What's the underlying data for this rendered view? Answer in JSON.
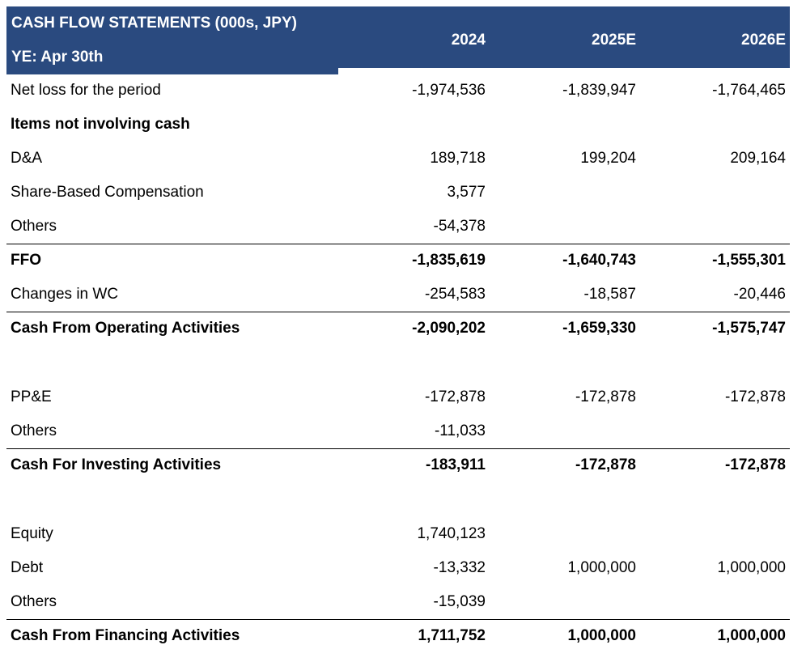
{
  "header": {
    "title": "CASH FLOW STATEMENTS (000s, JPY)",
    "subtitle": "YE: Apr 30th",
    "columns": [
      "2024",
      "2025E",
      "2026E"
    ]
  },
  "rows": [
    {
      "label": "Net loss for the period",
      "values": [
        "-1,974,536",
        "-1,839,947",
        "-1,764,465"
      ]
    },
    {
      "label": "Items not involving cash",
      "values": [
        "",
        "",
        ""
      ]
    },
    {
      "label": "D&A",
      "values": [
        "189,718",
        "199,204",
        "209,164"
      ]
    },
    {
      "label": "Share-Based Compensation",
      "values": [
        "3,577",
        "",
        ""
      ]
    },
    {
      "label": "Others",
      "values": [
        "-54,378",
        "",
        ""
      ]
    },
    {
      "label": "FFO",
      "values": [
        "-1,835,619",
        "-1,640,743",
        "-1,555,301"
      ]
    },
    {
      "label": "Changes in WC",
      "values": [
        "-254,583",
        "-18,587",
        "-20,446"
      ]
    },
    {
      "label": "Cash From Operating Activities",
      "values": [
        "-2,090,202",
        "-1,659,330",
        "-1,575,747"
      ]
    },
    {
      "label": "",
      "values": [
        "",
        "",
        ""
      ]
    },
    {
      "label": "PP&E",
      "values": [
        "-172,878",
        "-172,878",
        "-172,878"
      ]
    },
    {
      "label": "Others",
      "values": [
        "-11,033",
        "",
        ""
      ]
    },
    {
      "label": "Cash For Investing Activities",
      "values": [
        "-183,911",
        "-172,878",
        "-172,878"
      ]
    },
    {
      "label": "",
      "values": [
        "",
        "",
        ""
      ]
    },
    {
      "label": "Equity",
      "values": [
        "1,740,123",
        "",
        ""
      ]
    },
    {
      "label": "Debt",
      "values": [
        "-13,332",
        "1,000,000",
        "1,000,000"
      ]
    },
    {
      "label": "Others",
      "values": [
        "-15,039",
        "",
        ""
      ]
    },
    {
      "label": "Cash From Financing Activities",
      "values": [
        "1,711,752",
        "1,000,000",
        "1,000,000"
      ]
    }
  ]
}
